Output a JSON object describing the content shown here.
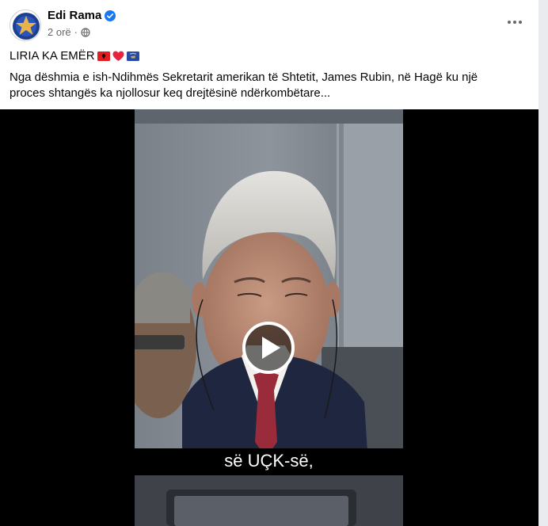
{
  "post": {
    "author": "Edi Rama",
    "time": "2 orë",
    "separator": "·",
    "headline": "LIRIA KA EMËR",
    "body": "Nga dëshmia e ish-Ndihmës Sekretarit amerikan të Shtetit, James Rubin, në Hagë ku një proces shtangës ka njollosur keq drejtësinë ndërkombëtare..."
  },
  "video": {
    "caption": "së UÇK-së,"
  },
  "icons": {
    "verified": "verified-badge-icon",
    "audience": "globe-icon",
    "more": "more-options-icon",
    "play": "play-icon"
  },
  "colors": {
    "verified": "#1877f2",
    "albania_flag": "#e41e20",
    "heart": "#e8243c",
    "kosovo_flag": "#244aa5"
  }
}
